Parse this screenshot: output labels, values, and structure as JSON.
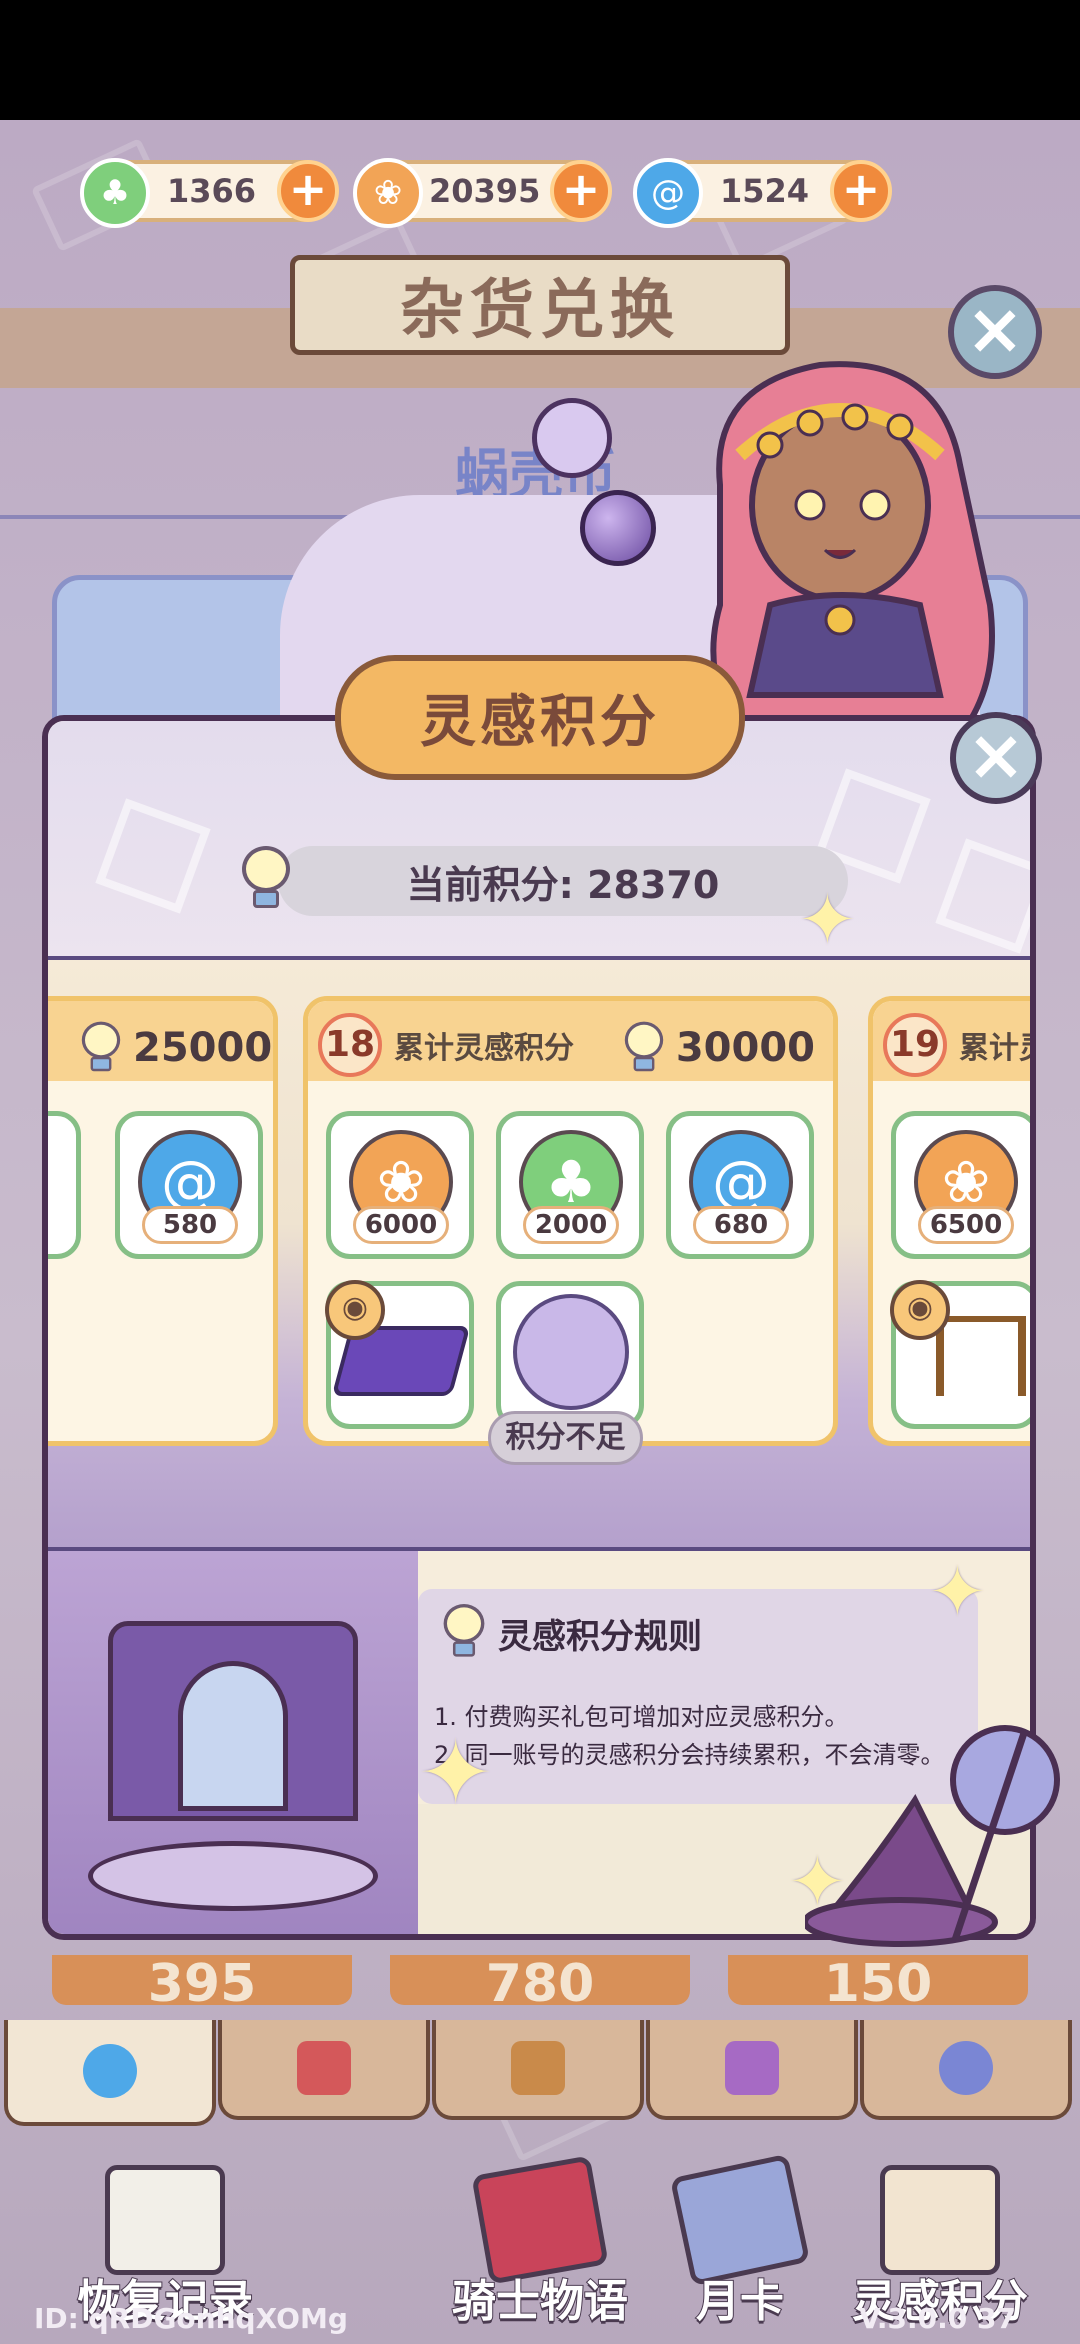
{
  "currencies": [
    {
      "name": "clover",
      "icon": "clover-icon",
      "value": "1366",
      "color": "#7fcf7c"
    },
    {
      "name": "shell",
      "icon": "shell-icon",
      "value": "20395",
      "color": "#f2a456"
    },
    {
      "name": "swirl",
      "icon": "swirl-icon",
      "value": "1524",
      "color": "#4ea8e8"
    }
  ],
  "shop": {
    "title": "杂货兑换",
    "tab_label": "蜗壳币"
  },
  "modal": {
    "title": "灵感积分",
    "current_points_label": "当前积分: 28370",
    "tiers": [
      {
        "level": "",
        "label": "",
        "required": "25000",
        "items": [
          {
            "type": "swirl",
            "qty": "580"
          }
        ]
      },
      {
        "level": "18",
        "label": "累计灵感积分",
        "required": "30000",
        "items": [
          {
            "type": "shell",
            "qty": "6000"
          },
          {
            "type": "clover",
            "qty": "2000"
          },
          {
            "type": "swirl",
            "qty": "680"
          },
          {
            "type": "purple-tile",
            "qty": ""
          },
          {
            "type": "cat-avatar",
            "qty": ""
          }
        ],
        "status": "积分不足"
      },
      {
        "level": "19",
        "label": "累计灵",
        "required": "",
        "items": [
          {
            "type": "shell",
            "qty": "6500"
          },
          {
            "type": "fence",
            "qty": ""
          }
        ]
      }
    ],
    "rules": {
      "title": "灵感积分规则",
      "lines": [
        "1. 付费购买礼包可增加对应灵感积分。",
        "2. 同一账号的灵感积分会持续累积，不会清零。"
      ]
    }
  },
  "price_tabs": [
    "395",
    "780",
    "150"
  ],
  "bottom_nav": [
    {
      "label": "恢复记录",
      "icon": "clipboard-icon"
    },
    {
      "label": "骑士物语",
      "icon": "sword-icon"
    },
    {
      "label": "月卡",
      "icon": "card-icon"
    },
    {
      "label": "灵感积分",
      "icon": "bulb-icon"
    }
  ],
  "footer": {
    "id_text": "ID:  qRDGonhqXOMg",
    "version": "V.3.0.0 37"
  },
  "colors": {
    "accent": "#f3b864",
    "modal_border": "#4a2f52",
    "item_border": "#86bf86",
    "plus_button": "#f08a3c"
  }
}
